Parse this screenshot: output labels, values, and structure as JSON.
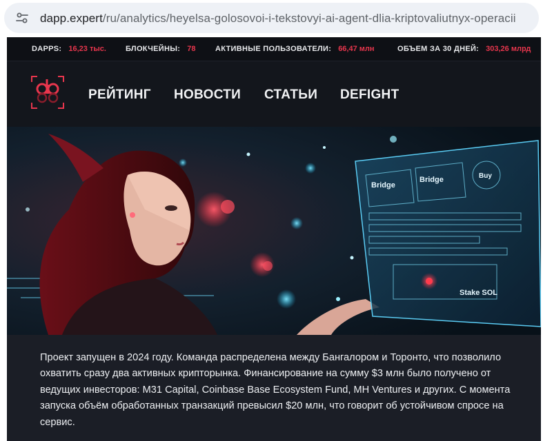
{
  "browser": {
    "url_host": "dapp.expert",
    "url_path": "/ru/analytics/heyelsa-golosovoi-i-tekstovyi-ai-agent-dlia-kriptovaliutnyx-operacii"
  },
  "stats": [
    {
      "label": "DAPPS:",
      "value": "16,23 тыс."
    },
    {
      "label": "БЛОКЧЕЙНЫ:",
      "value": "78"
    },
    {
      "label": "АКТИВНЫЕ ПОЛЬЗОВАТЕЛИ:",
      "value": "66,47 млн"
    },
    {
      "label": "ОБЪЕМ ЗА 30 ДНЕЙ:",
      "value": "303,26 млрд"
    }
  ],
  "nav": {
    "items": [
      "РЕЙТИНГ",
      "НОВОСТИ",
      "СТАТЬИ",
      "DEFIGHT"
    ]
  },
  "hero": {
    "screen_labels": [
      "Bridge",
      "Bridge",
      "Buy",
      "Stake SOL"
    ]
  },
  "article": {
    "text": "Проект запущен в 2024 году. Команда распределена между Бангалором и Торонто, что позволило охватить сразу два активных крипторынка. Финансирование на сумму $3 млн было получено от ведущих инвесторов: M31 Capital, Coinbase Base Ecosystem Fund, MH Ventures и других. С момента запуска объём обработанных транзакций превысил $20 млн, что говорит об устойчивом спросе на сервис."
  },
  "colors": {
    "accent": "#e8364d",
    "site_bg": "#13161c",
    "article_bg": "#1b1e26"
  }
}
